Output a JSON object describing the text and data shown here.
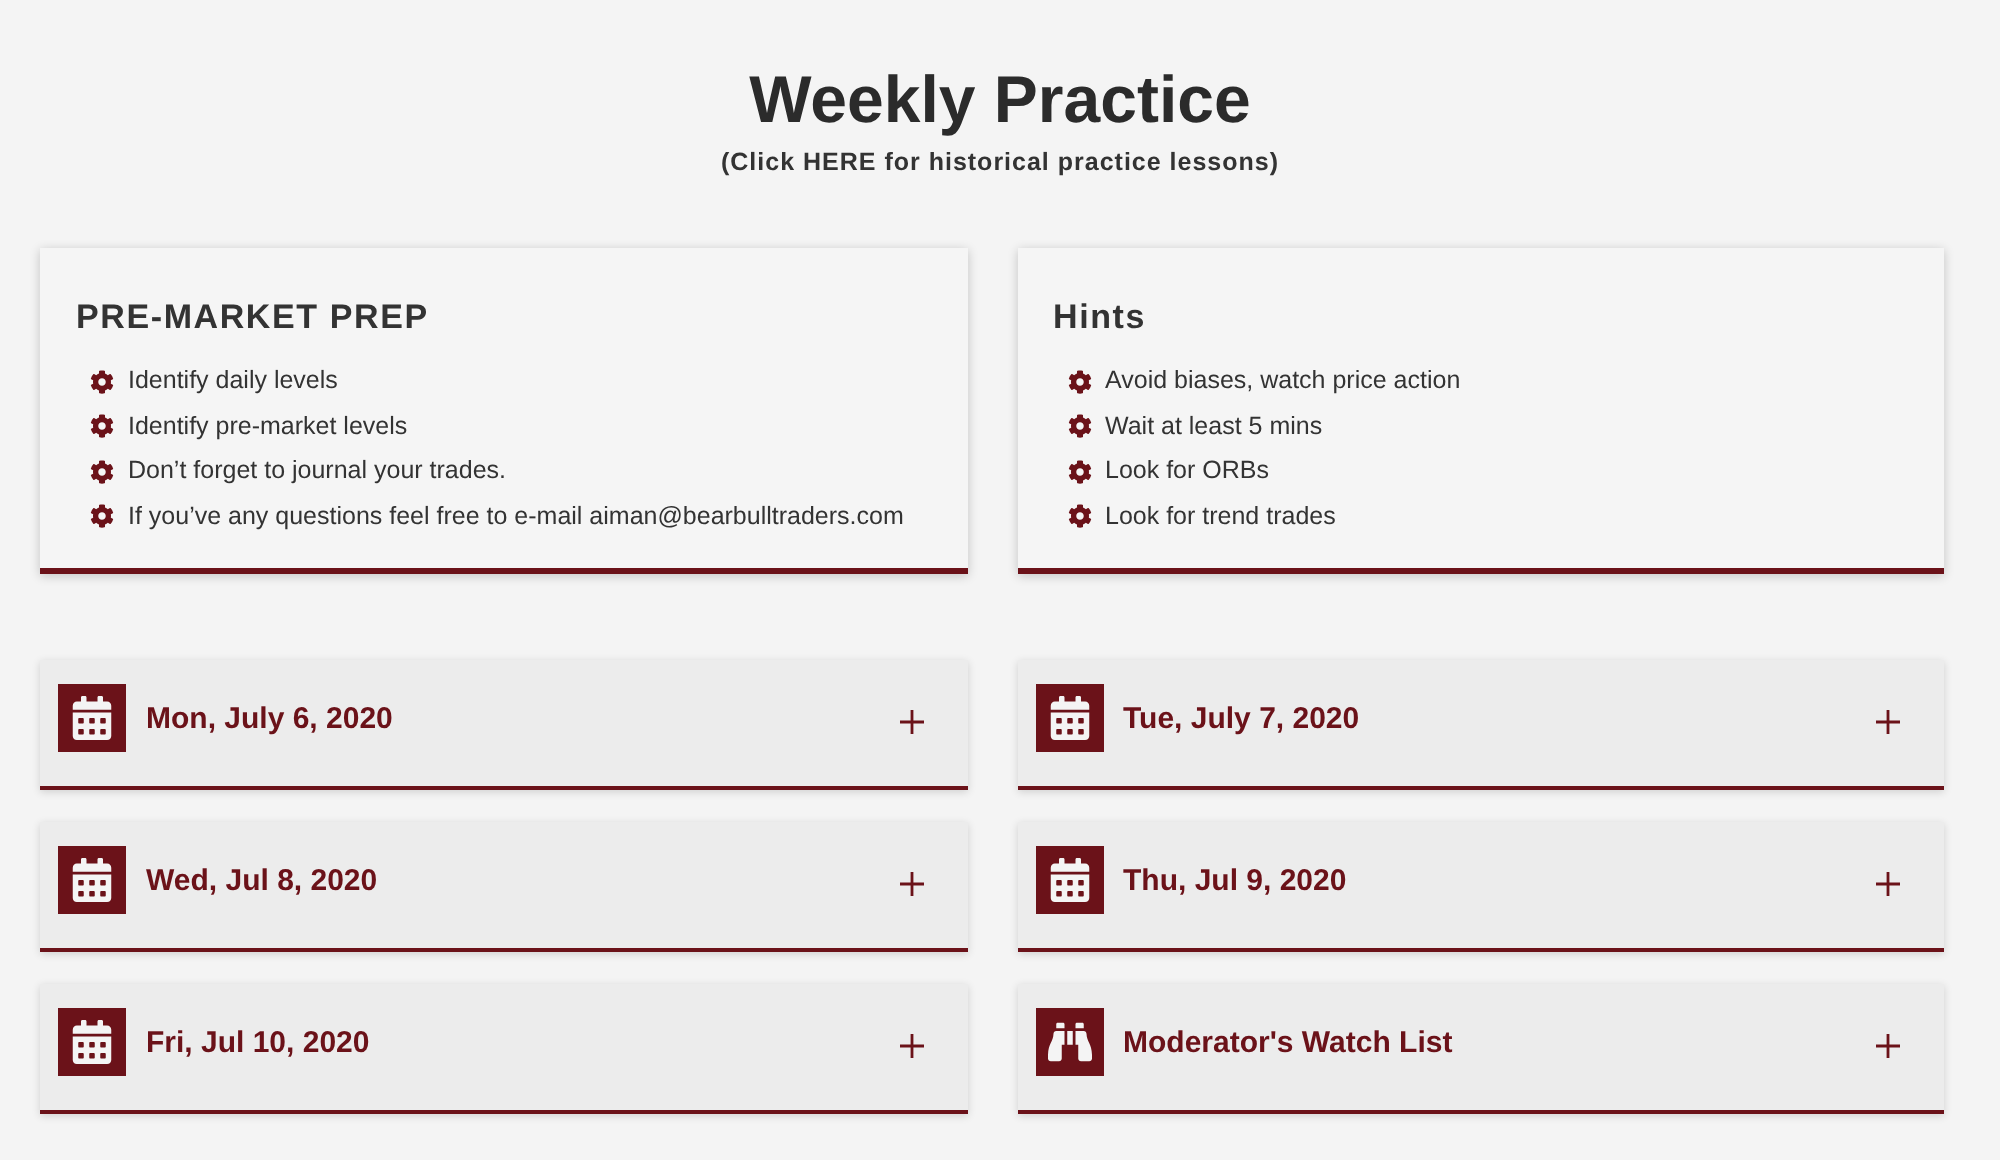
{
  "header": {
    "title": "Weekly Practice",
    "subtitle": "(Click HERE for historical practice lessons)"
  },
  "info_cards": [
    {
      "title": "PRE-MARKET PREP",
      "items": [
        "Identify daily levels",
        "Identify pre-market levels",
        "Don’t forget to journal your trades.",
        "If you’ve any questions feel free to e-mail aiman@bearbulltraders.com"
      ]
    },
    {
      "title": "Hints",
      "items": [
        "Avoid biases, watch price action",
        "Wait at least 5 mins",
        "Look for ORBs",
        "Look for trend trades"
      ]
    }
  ],
  "sections": [
    {
      "kind": "calendar",
      "title": "Mon, July 6, 2020",
      "expanded": false
    },
    {
      "kind": "calendar",
      "title": "Tue, July 7, 2020",
      "expanded": false
    },
    {
      "kind": "calendar",
      "title": "Wed, Jul 8, 2020",
      "expanded": false
    },
    {
      "kind": "calendar",
      "title": "Thu, Jul 9, 2020",
      "expanded": false
    },
    {
      "kind": "calendar",
      "title": "Fri, Jul 10, 2020",
      "expanded": false
    },
    {
      "kind": "binoculars",
      "title": "Moderator's Watch List",
      "expanded": false
    }
  ]
}
